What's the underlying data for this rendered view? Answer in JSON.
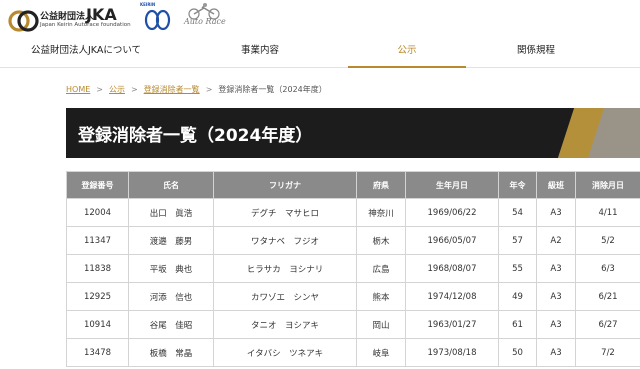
{
  "header": {
    "jka_logo_top": "公益財団法人",
    "jka_logo_big": "JKA",
    "jka_logo_sub": "Japan Keirin Autorace foundation",
    "keirin_logo_text": "KEIRIN",
    "auto_logo_text": "Auto Race"
  },
  "nav": {
    "items": [
      {
        "label": "公益財団法人JKAについて"
      },
      {
        "label": "事業内容"
      },
      {
        "label": "公示"
      },
      {
        "label": "関係規程"
      }
    ],
    "active_index": 2
  },
  "breadcrumb": {
    "home": "HOME",
    "notice": "公示",
    "list": "登録消除者一覧",
    "current": "登録消除者一覧（2024年度）",
    "separator": ">"
  },
  "page": {
    "title": "登録消除者一覧（2024年度）"
  },
  "colors": {
    "accent": "#b8892e",
    "title_bg": "#1c1c1c",
    "header_bg": "#8a8a8a"
  },
  "table": {
    "headers": [
      "登録番号",
      "氏名",
      "フリガナ",
      "府県",
      "生年月日",
      "年令",
      "級班",
      "消除月日"
    ],
    "rows": [
      [
        "12004",
        "出口　眞浩",
        "デグチ　マサヒロ",
        "神奈川",
        "1969/06/22",
        "54",
        "A3",
        "4/11"
      ],
      [
        "11347",
        "渡邉　藤男",
        "ワタナベ　フジオ",
        "栃木",
        "1966/05/07",
        "57",
        "A2",
        "5/2"
      ],
      [
        "11838",
        "平坂　典也",
        "ヒラサカ　ヨシナリ",
        "広島",
        "1968/08/07",
        "55",
        "A3",
        "6/3"
      ],
      [
        "12925",
        "河添　信也",
        "カワゾエ　シンヤ",
        "熊本",
        "1974/12/08",
        "49",
        "A3",
        "6/21"
      ],
      [
        "10914",
        "谷尾　佳昭",
        "タニオ　ヨシアキ",
        "岡山",
        "1963/01/27",
        "61",
        "A3",
        "6/27"
      ],
      [
        "13478",
        "板橋　常晶",
        "イタバシ　ツネアキ",
        "岐阜",
        "1973/08/18",
        "50",
        "A3",
        "7/2"
      ]
    ]
  }
}
